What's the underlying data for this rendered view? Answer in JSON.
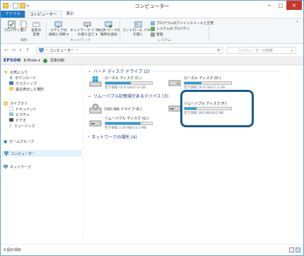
{
  "window": {
    "title": "コンピューター"
  },
  "tabs": [
    "ファイル",
    "コンピューター",
    "表示"
  ],
  "ribbon": {
    "location_group": {
      "label": "場所",
      "buttons": [
        {
          "label": "プロパティ"
        },
        {
          "label": "開く"
        },
        {
          "label": "名前の\n変更"
        }
      ]
    },
    "network_group": {
      "label": "ネットワーク",
      "buttons": [
        {
          "label": "メディアの\n接続と切断 ▾"
        },
        {
          "label": "ネットワーク ドライブ\nの割り当て ▾"
        },
        {
          "label": "ネットワークの\n場所の追加"
        }
      ]
    },
    "system_group": {
      "label": "システム",
      "big_button": "コントロール パネル\nを開く",
      "small_buttons": [
        "プログラムのアンインストールと変更",
        "システムのプロパティ",
        "管理"
      ]
    }
  },
  "address": {
    "path": "コンピューター",
    "search_placeholder": "コンピューターの検索"
  },
  "epson_bar": {
    "logo": "EPSON",
    "item1": "E-Photo ▾",
    "item2": "写真印刷"
  },
  "nav": {
    "favorites": "お気に入り",
    "fav_items": [
      "ダウンロード",
      "デスクトップ",
      "最近表示した場所"
    ],
    "libraries": "ライブラリ",
    "lib_items": [
      "ドキュメント",
      "ピクチャ",
      "ビデオ",
      "ミュージック"
    ],
    "homegroup": "ホームグループ",
    "computer": "コンピューター",
    "network": "ネットワーク"
  },
  "content": {
    "hdd_header": "ハード ディスク ドライブ (2)",
    "removable_header": "リムーバブル記憶域があるデバイス (3)",
    "network_header": "ネットワークの場所 (4)",
    "drives": [
      {
        "name": "ローカル ディスク (C:)",
        "free": "空き領域 16.9 GB/37.0 GB",
        "used_fraction": 0.54
      },
      {
        "name": "ローカル ディスク (D:)",
        "free": "空き領域 16.9 GB/27.0 GB",
        "used_fraction": 0.37
      },
      {
        "name": "リムーバブル ディスク (F:)",
        "free": "空き領域 364 MB/495 MB",
        "used_fraction": 0.26
      },
      {
        "name": "DVD RW ドライブ (E:)"
      },
      {
        "name": "リムーバブル ディスク (G:)",
        "free": "空き領域 3.59 MB/14.1 MB",
        "used_fraction": 0.75
      }
    ]
  },
  "status": {
    "items": "9 個の項目"
  }
}
